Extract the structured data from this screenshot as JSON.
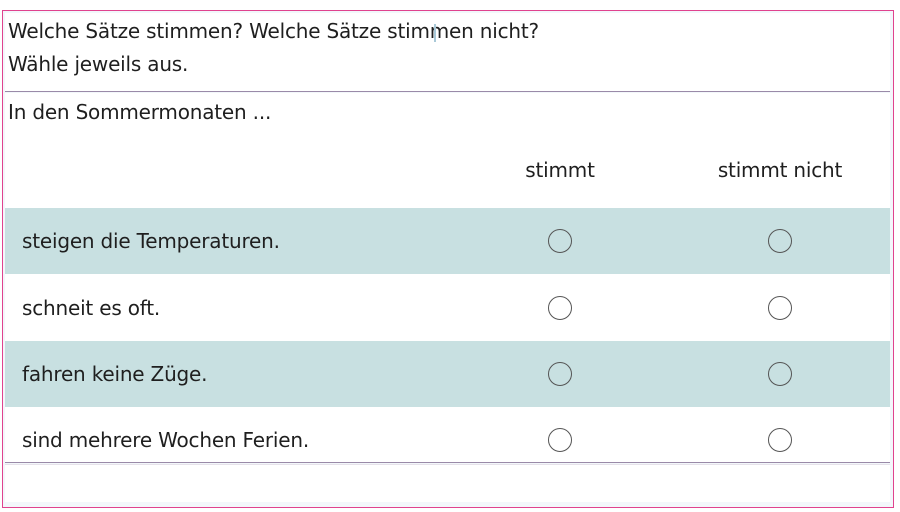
{
  "instruction": {
    "line1": "Welche Sätze stimmen? Welche Sätze stimmen nicht?",
    "line2": "Wähle jeweils aus."
  },
  "question": {
    "lead": "In den Sommermonaten ...",
    "columns": [
      "stimmt",
      "stimmt nicht"
    ],
    "rows": [
      {
        "label": "steigen die Temperaturen.",
        "shaded": true
      },
      {
        "label": "schneit es oft.",
        "shaded": false
      },
      {
        "label": "fahren keine Züge.",
        "shaded": true
      },
      {
        "label": "sind mehrere Wochen Ferien.",
        "shaded": false
      }
    ]
  },
  "colors": {
    "frame_border": "#e0438e",
    "row_shade": "#c8e0e1"
  }
}
